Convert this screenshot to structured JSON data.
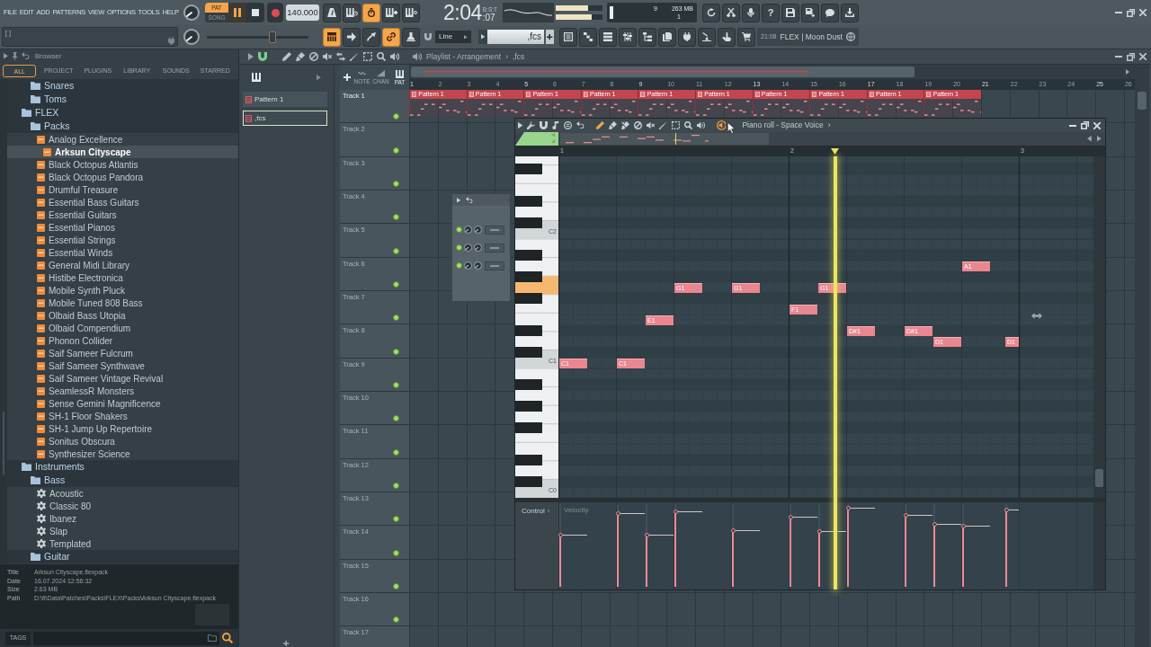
{
  "toolbar": {
    "menu": [
      "FILE",
      "EDIT",
      "ADD",
      "PATTERNS",
      "VIEW",
      "OPTIONS",
      "TOOLS",
      "HELP"
    ],
    "modes": [
      {
        "label": "PAT",
        "selected": true
      },
      {
        "label": "SONG",
        "selected": false
      }
    ],
    "playing": true,
    "tempo": "140.000",
    "toggles_top": [
      {
        "on": false
      },
      {
        "on": false
      },
      {
        "on": true
      },
      {
        "on": false
      },
      {
        "on": false
      }
    ],
    "time": "2:04",
    "time_format": "B:S:T",
    "time_ticks": ":07",
    "meters": [
      {
        "level": 0.7
      },
      {
        "level": 0.77
      }
    ],
    "readings": [
      "9",
      "263 MB",
      "1"
    ],
    "help": "?",
    "hint": "[ ]",
    "pitch_slider": {
      "level": 0.65
    },
    "toggles_bottom": [
      {
        "on": true
      },
      {
        "on": false
      },
      {
        "on": false
      },
      {
        "on": true
      },
      {
        "on": false
      }
    ],
    "snap": "Line",
    "pattern": ",fcs",
    "news_time": "21:08",
    "news": "FLEX | Moon Dust"
  },
  "browser": {
    "title": "Browser",
    "tabs": [
      {
        "label": "ALL",
        "selected": true
      },
      {
        "label": "PROJECT",
        "selected": false
      },
      {
        "label": "PLUGINS",
        "selected": false
      },
      {
        "label": "LIBRARY",
        "selected": false
      },
      {
        "label": "SOUNDS",
        "selected": false
      },
      {
        "label": "STARRED",
        "selected": false
      }
    ],
    "tree": [
      {
        "children": [
          {
            "label": "Snares",
            "kind": "folder",
            "selected": false
          },
          {
            "label": "Toms",
            "kind": "folder",
            "selected": false
          }
        ]
      },
      {
        "label": "FLEX",
        "kind": "folder",
        "selected": false,
        "children": [
          {
            "label": "Packs",
            "kind": "folder",
            "selected": false,
            "children": [
              {
                "label": "Analog Excellence",
                "kind": "pack",
                "selected": false
              },
              {
                "label": "Arksun Cityscape",
                "kind": "pack",
                "selected": true
              },
              {
                "label": "Black Octopus Atlantis",
                "kind": "pack",
                "selected": false
              },
              {
                "label": "Black Octopus Pandora",
                "kind": "pack",
                "selected": false
              },
              {
                "label": "Drumful Treasure",
                "kind": "pack",
                "selected": false
              },
              {
                "label": "Essential Bass Guitars",
                "kind": "pack",
                "selected": false
              },
              {
                "label": "Essential Guitars",
                "kind": "pack",
                "selected": false
              },
              {
                "label": "Essential Pianos",
                "kind": "pack",
                "selected": false
              },
              {
                "label": "Essential Strings",
                "kind": "pack",
                "selected": false
              },
              {
                "label": "Essential Winds",
                "kind": "pack",
                "selected": false
              },
              {
                "label": "General Midi Library",
                "kind": "pack",
                "selected": false
              },
              {
                "label": "Histibe Electronica",
                "kind": "pack",
                "selected": false
              },
              {
                "label": "Mobile Synth Pluck",
                "kind": "pack",
                "selected": false
              },
              {
                "label": "Mobile Tuned 808 Bass",
                "kind": "pack",
                "selected": false
              },
              {
                "label": "Olbaid Bass Utopia",
                "kind": "pack",
                "selected": false
              },
              {
                "label": "Olbaid Compendium",
                "kind": "pack",
                "selected": false
              },
              {
                "label": "Phonon Collider",
                "kind": "pack",
                "selected": false
              },
              {
                "label": "Saif Sameer Fulcrum",
                "kind": "pack",
                "selected": false
              },
              {
                "label": "Saif Sameer Synthwave",
                "kind": "pack",
                "selected": false
              },
              {
                "label": "Saif Sameer Vintage Revival",
                "kind": "pack",
                "selected": false
              },
              {
                "label": "SeamlessR Monsters",
                "kind": "pack",
                "selected": false
              },
              {
                "label": "Sense Gemini Magnificence",
                "kind": "pack",
                "selected": false
              },
              {
                "label": "SH-1 Floor Shakers",
                "kind": "pack",
                "selected": false
              },
              {
                "label": "SH-1 Jump Up Repertoire",
                "kind": "pack",
                "selected": false
              },
              {
                "label": "Sonitus Obscura",
                "kind": "pack",
                "selected": false
              },
              {
                "label": "Synthesizer Science",
                "kind": "pack",
                "selected": false
              }
            ]
          }
        ]
      },
      {
        "label": "Instruments",
        "kind": "folder",
        "selected": false,
        "children": [
          {
            "label": "Bass",
            "kind": "folder",
            "selected": false,
            "children": [
              {
                "label": "Acoustic",
                "kind": "preset",
                "selected": false
              },
              {
                "label": "Classic 80",
                "kind": "preset",
                "selected": false
              },
              {
                "label": "Ibanez",
                "kind": "preset",
                "selected": false
              },
              {
                "label": "Slap",
                "kind": "preset",
                "selected": false
              },
              {
                "label": "Templated",
                "kind": "preset",
                "selected": false
              }
            ]
          },
          {
            "label": "Guitar",
            "kind": "folder",
            "selected": false
          }
        ]
      }
    ],
    "info": [
      {
        "label": "Title",
        "value": "Arksun Cityscape.flexpack"
      },
      {
        "label": "Date",
        "value": "16.07.2024 12:56:32"
      },
      {
        "label": "Size",
        "value": "2.63 MB"
      },
      {
        "label": "Path",
        "value": "D:\\fl\\Data\\Patches\\Packs\\FLEX\\Packs\\Arksun Cityscape.flexpack"
      }
    ],
    "tags": "TAGS"
  },
  "picker": [
    {
      "label": "Pattern 1",
      "selected": false
    },
    {
      "label": ",fcs",
      "selected": true
    }
  ],
  "playlist": {
    "title": "Playlist - Arrangement",
    "separator": "›",
    "pattern": ",fcs",
    "snap_labels": [
      "NOTE",
      "CHAN",
      "PAT"
    ],
    "ruler": [
      "1",
      "2",
      "3",
      "4",
      "5",
      "6",
      "7",
      "8",
      "9",
      "10",
      "11",
      "12",
      "13",
      "14",
      "15",
      "16",
      "17",
      "18",
      "19",
      "20",
      "21",
      "22",
      "23",
      "24",
      "25",
      "26"
    ],
    "tracks": [
      {
        "label": "Track 1",
        "active": true,
        "clips": [
          {
            "label": "Pattern 1"
          },
          {
            "label": "Pattern 1"
          },
          {
            "label": "Pattern 1"
          },
          {
            "label": "Pattern 1"
          },
          {
            "label": "Pattern 1"
          },
          {
            "label": "Pattern 1"
          },
          {
            "label": "Pattern 1"
          },
          {
            "label": "Pattern 1"
          },
          {
            "label": "Pattern 1"
          },
          {
            "label": "Pattern 1"
          }
        ]
      },
      {
        "label": "Track 2",
        "active": false
      },
      {
        "label": "Track 3",
        "active": false
      },
      {
        "label": "Track 4",
        "active": false
      },
      {
        "label": "Track 5",
        "active": false
      },
      {
        "label": "Track 6",
        "active": false
      },
      {
        "label": "Track 7",
        "active": false
      },
      {
        "label": "Track 8",
        "active": false
      },
      {
        "label": "Track 9",
        "active": false
      },
      {
        "label": "Track 10",
        "active": false
      },
      {
        "label": "Track 11",
        "active": false
      },
      {
        "label": "Track 12",
        "active": false
      },
      {
        "label": "Track 13",
        "active": false
      },
      {
        "label": "Track 14",
        "active": false
      },
      {
        "label": "Track 15",
        "active": false
      },
      {
        "label": "Track 16",
        "active": false
      },
      {
        "label": "Track 17",
        "active": false
      }
    ]
  },
  "piano_roll": {
    "title": "Piano roll - Space Voice",
    "separator": "›",
    "ruler": [
      "1",
      "2",
      "3"
    ],
    "keys": [
      "C2",
      "C1",
      "C0"
    ],
    "notes": [
      {
        "label": "C1",
        "level": 0.63
      },
      {
        "label": "C1",
        "level": 0.89
      },
      {
        "label": "E1",
        "level": 0.63
      },
      {
        "label": "G1",
        "level": 0.91
      },
      {
        "label": "G1",
        "level": 0.68
      },
      {
        "label": "F1",
        "level": 0.84
      },
      {
        "label": "G1",
        "level": 0.67
      },
      {
        "label": "D#1",
        "level": 0.95
      },
      {
        "label": "D#1",
        "level": 0.86
      },
      {
        "label": "D1",
        "level": 0.76
      },
      {
        "label": "A1",
        "level": 0.73
      },
      {
        "label": "D1",
        "level": 0.93
      }
    ],
    "control": {
      "label": "Control",
      "separator": "›",
      "parameter": "Velocity"
    }
  }
}
